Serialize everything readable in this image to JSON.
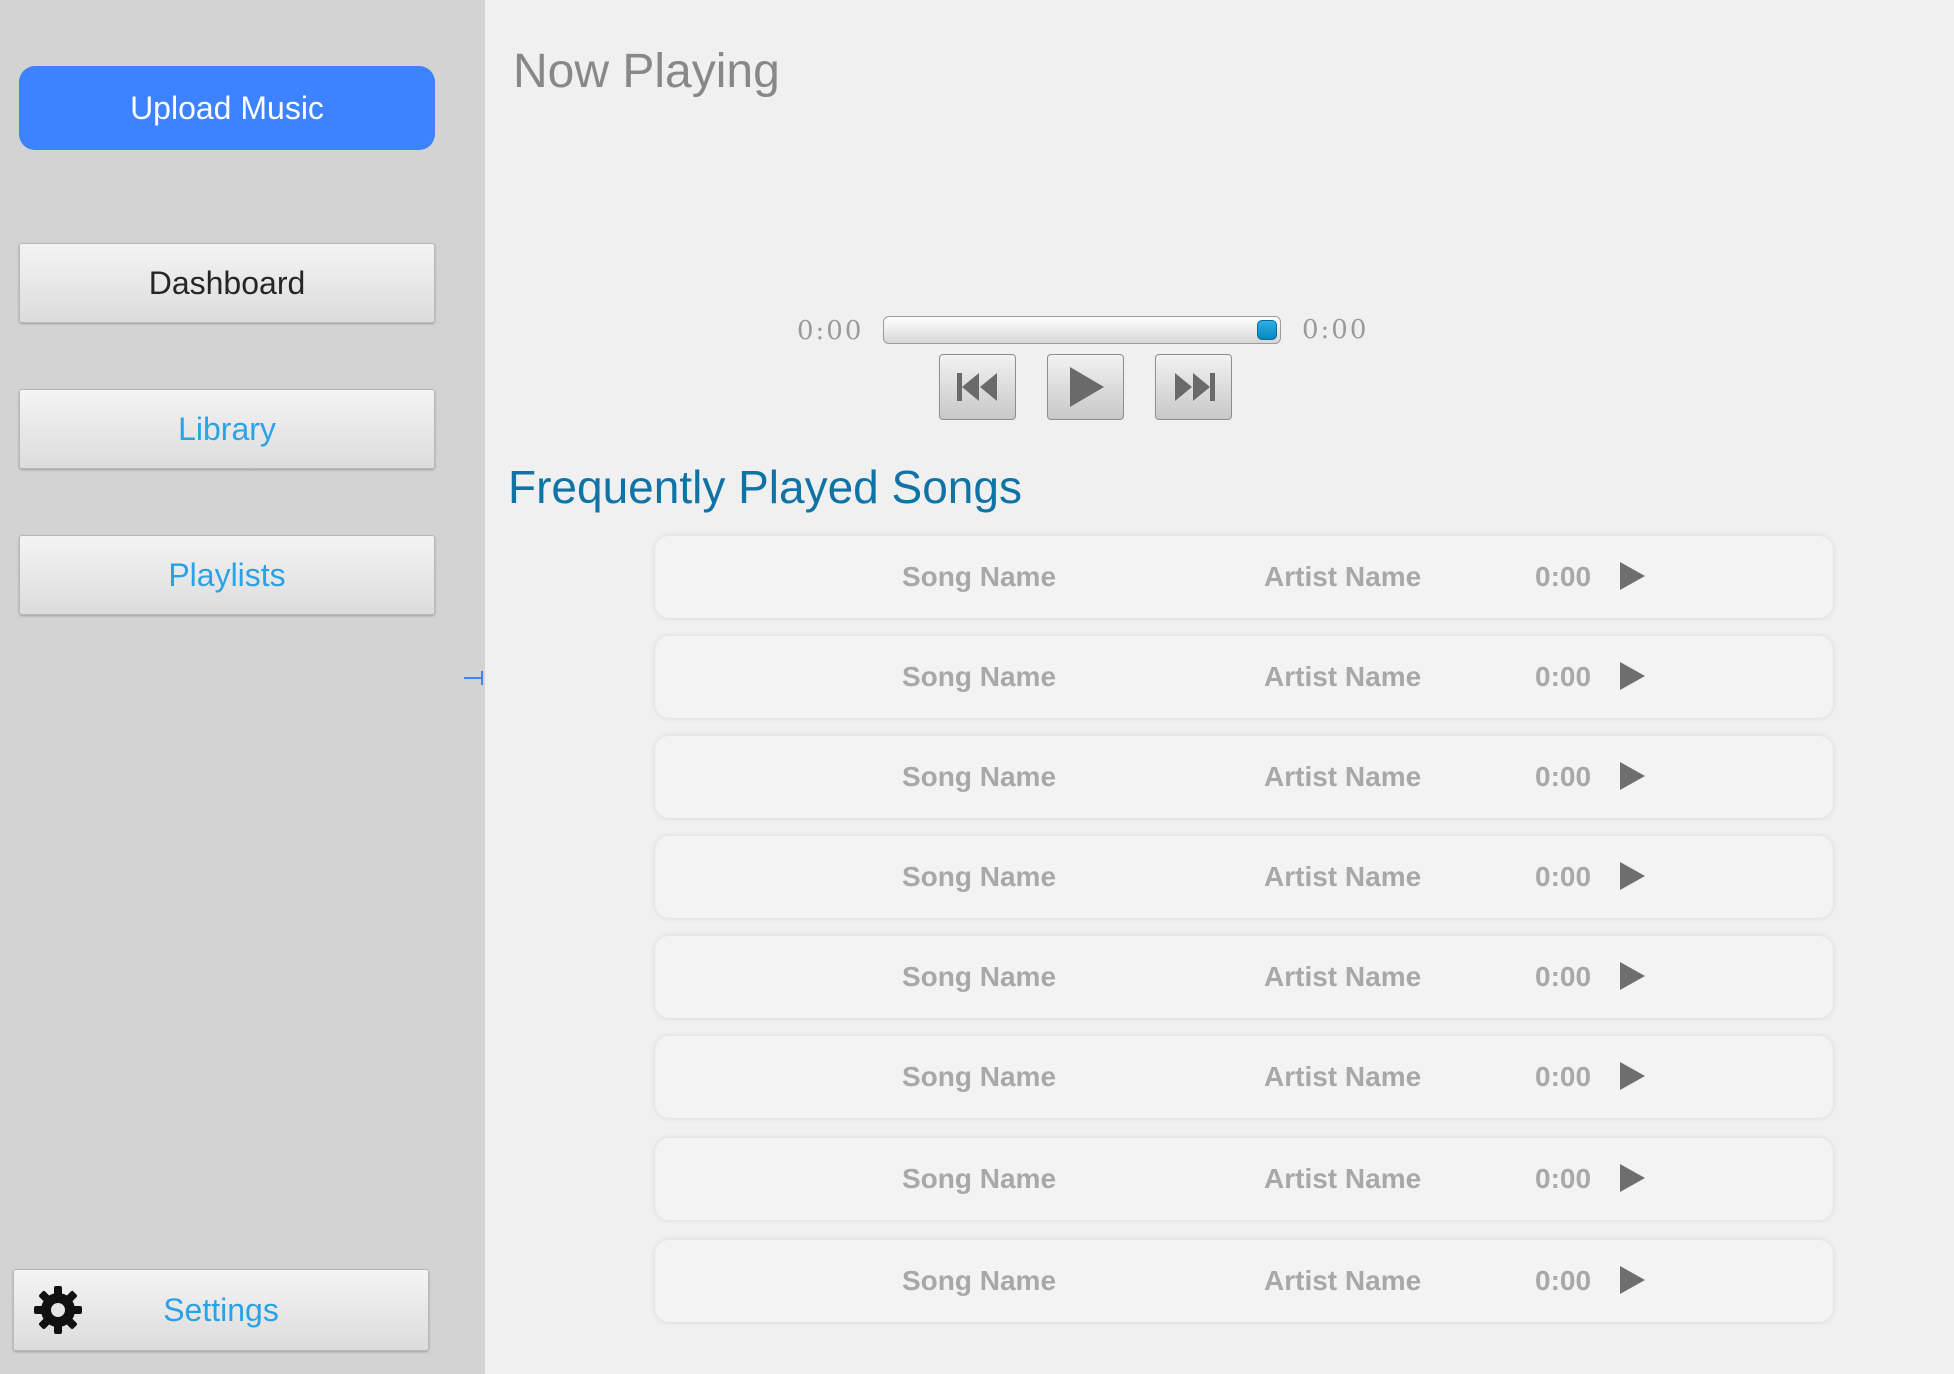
{
  "sidebar": {
    "upload_label": "Upload Music",
    "nav": {
      "dashboard": "Dashboard",
      "library": "Library",
      "playlists": "Playlists"
    },
    "settings_label": "Settings"
  },
  "player": {
    "title": "Now Playing",
    "elapsed": "0:00",
    "duration": "0:00",
    "progress": 1.0
  },
  "frequent": {
    "title": "Frequently Played Songs",
    "songs": [
      {
        "name": "Song Name",
        "artist": "Artist Name",
        "time": "0:00"
      },
      {
        "name": "Song Name",
        "artist": "Artist Name",
        "time": "0:00"
      },
      {
        "name": "Song Name",
        "artist": "Artist Name",
        "time": "0:00"
      },
      {
        "name": "Song Name",
        "artist": "Artist Name",
        "time": "0:00"
      },
      {
        "name": "Song Name",
        "artist": "Artist Name",
        "time": "0:00"
      },
      {
        "name": "Song Name",
        "artist": "Artist Name",
        "time": "0:00"
      },
      {
        "name": "Song Name",
        "artist": "Artist Name",
        "time": "0:00"
      },
      {
        "name": "Song Name",
        "artist": "Artist Name",
        "time": "0:00"
      }
    ]
  },
  "colors": {
    "accent": "#3d82fe",
    "link": "#2aa3e6",
    "section_title": "#0f73a6",
    "sidebar_bg": "#d3d3d3",
    "main_bg": "#f0f0f0"
  },
  "icons": {
    "settings": "gear-icon",
    "collapse": "collapse-arrow-icon",
    "rewind": "rewind-icon",
    "play": "play-icon",
    "forward": "fast-forward-icon",
    "row_play": "play-icon"
  }
}
